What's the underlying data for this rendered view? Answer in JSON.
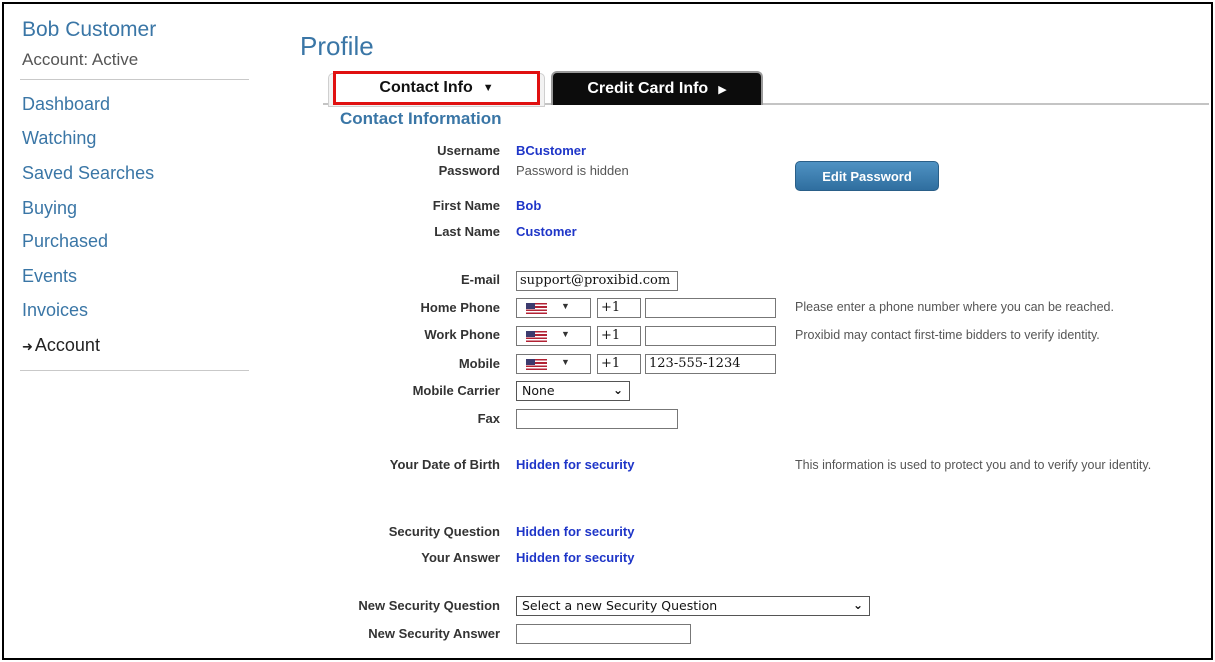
{
  "sidebar": {
    "user_name": "Bob Customer",
    "account_status": "Account: Active",
    "items": [
      {
        "label": "Dashboard"
      },
      {
        "label": "Watching"
      },
      {
        "label": "Saved Searches"
      },
      {
        "label": "Buying"
      },
      {
        "label": "Purchased"
      },
      {
        "label": "Events"
      },
      {
        "label": "Invoices"
      },
      {
        "label": "Account",
        "current": true
      }
    ]
  },
  "page": {
    "title": "Profile",
    "tabs": [
      {
        "label": "Contact Info",
        "icon": "caret-down-icon",
        "active": true,
        "highlighted": true
      },
      {
        "label": "Credit Card Info",
        "icon": "caret-right-icon",
        "active": false
      }
    ],
    "section_title": "Contact Information"
  },
  "form": {
    "username": {
      "label": "Username",
      "value": "BCustomer"
    },
    "password": {
      "label": "Password",
      "value": "Password is hidden",
      "button": "Edit Password"
    },
    "first_name": {
      "label": "First Name",
      "value": "Bob"
    },
    "last_name": {
      "label": "Last Name",
      "value": "Customer"
    },
    "email": {
      "label": "E-mail",
      "value": "support@proxibid.com"
    },
    "home_phone": {
      "label": "Home Phone",
      "country_code": "+1",
      "number": "",
      "hint": "Please enter a phone number where you can be reached."
    },
    "work_phone": {
      "label": "Work Phone",
      "country_code": "+1",
      "number": "",
      "hint": "Proxibid may contact first-time bidders to verify identity."
    },
    "mobile": {
      "label": "Mobile",
      "country_code": "+1",
      "number": "123-555-1234"
    },
    "mobile_carrier": {
      "label": "Mobile Carrier",
      "value": "None"
    },
    "fax": {
      "label": "Fax",
      "value": ""
    },
    "dob": {
      "label": "Your Date of Birth",
      "value": "Hidden for security",
      "hint": "This information is used to protect you and to verify your identity."
    },
    "security_question": {
      "label": "Security Question",
      "value": "Hidden for security"
    },
    "security_answer": {
      "label": "Your Answer",
      "value": "Hidden for security"
    },
    "new_security_question": {
      "label": "New Security Question",
      "value": "Select a new Security Question"
    },
    "new_security_answer": {
      "label": "New Security Answer",
      "value": ""
    }
  },
  "colors": {
    "link": "#3a76a6",
    "value": "#1e35c8",
    "highlight": "#e01010"
  }
}
